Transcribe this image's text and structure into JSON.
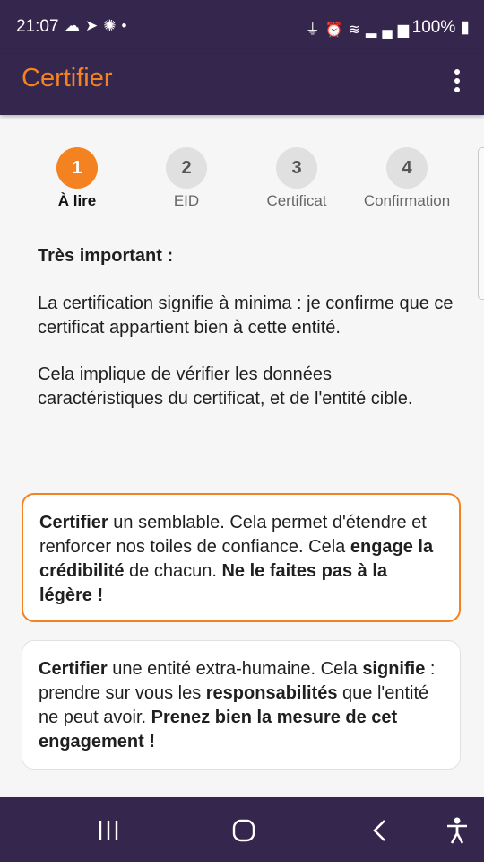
{
  "status_bar": {
    "time": "21:07",
    "left_icons": [
      "cloud-icon",
      "telegram-icon",
      "signal-icon",
      "dot-icon"
    ],
    "right_icons": [
      "usb-icon",
      "alarm-icon",
      "wifi-icon",
      "cell-signal-icon",
      "battery-icon"
    ],
    "battery": "100%"
  },
  "app_bar": {
    "title": "Certifier"
  },
  "colors": {
    "primary_dark": "#35264d",
    "accent": "#f58220",
    "background": "#f6f6f6"
  },
  "steps": [
    {
      "number": "1",
      "label": "À lire",
      "active": true
    },
    {
      "number": "2",
      "label": "EID",
      "active": false
    },
    {
      "number": "3",
      "label": "Certificat",
      "active": false
    },
    {
      "number": "4",
      "label": "Confirmation",
      "active": false
    }
  ],
  "intro": {
    "heading": "Très important :",
    "p1": "La certification signifie à minima : je confirme que ce certificat appartient bien à cette entité.",
    "p2": "Cela implique de vérifier les données caractéristiques du certificat, et de l'entité cible."
  },
  "card1": {
    "b1": "Certifier",
    "t1": " un semblable. Cela permet d'étendre et renforcer nos toiles de confiance. Cela ",
    "b2": "engage la crédibilité",
    "t2": " de chacun. ",
    "b3": "Ne le faites pas à la légère !"
  },
  "card2": {
    "b1": "Certifier",
    "t1": " une entité extra-humaine. Cela ",
    "b2": "signifie",
    "t2": " : prendre sur vous les ",
    "b3": "responsabilités",
    "t3": " que l'entité ne peut avoir. ",
    "b4": "Prenez bien la mesure de cet engagement !"
  },
  "nav_bar": {
    "icons": [
      "recent-apps-icon",
      "home-icon",
      "back-icon",
      "accessibility-icon"
    ]
  }
}
